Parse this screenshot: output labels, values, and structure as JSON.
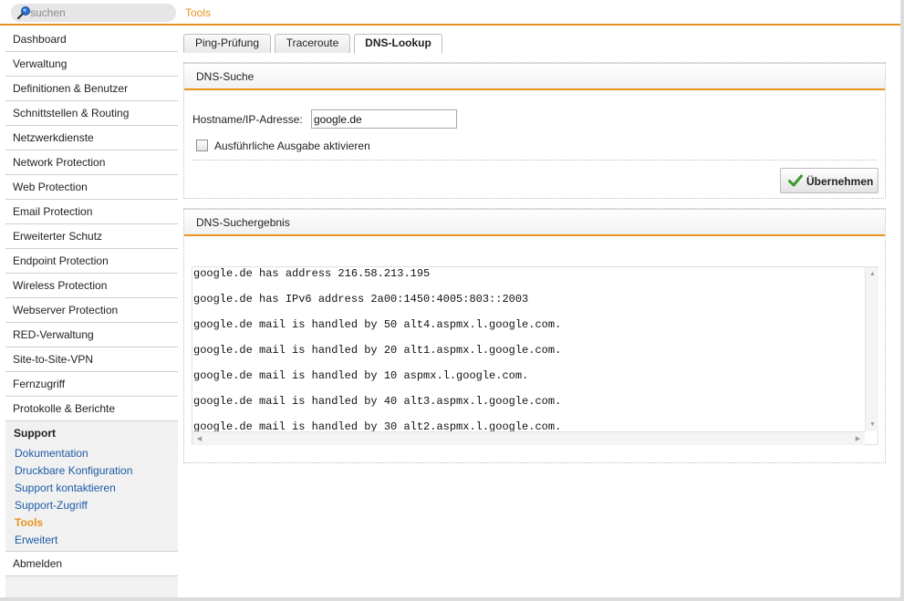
{
  "search": {
    "placeholder": "suchen"
  },
  "header": {
    "title": "Tools"
  },
  "sidebar": {
    "items": [
      "Dashboard",
      "Verwaltung",
      "Definitionen & Benutzer",
      "Schnittstellen & Routing",
      "Netzwerkdienste",
      "Network Protection",
      "Web Protection",
      "Email Protection",
      "Erweiterter Schutz",
      "Endpoint Protection",
      "Wireless Protection",
      "Webserver Protection",
      "RED-Verwaltung",
      "Site-to-Site-VPN",
      "Fernzugriff",
      "Protokolle & Berichte"
    ],
    "support": {
      "heading": "Support",
      "links": [
        "Dokumentation",
        "Druckbare Konfiguration",
        "Support kontaktieren",
        "Support-Zugriff",
        "Tools",
        "Erweitert"
      ],
      "active": "Tools"
    },
    "logout": "Abmelden"
  },
  "tabs": [
    {
      "label": "Ping-Prüfung",
      "active": false
    },
    {
      "label": "Traceroute",
      "active": false
    },
    {
      "label": "DNS-Lookup",
      "active": true
    }
  ],
  "dns_search": {
    "title": "DNS-Suche",
    "hostname_label": "Hostname/IP-Adresse:",
    "hostname_value": "google.de",
    "verbose_label": "Ausführliche Ausgabe aktivieren",
    "verbose_checked": false,
    "apply_label": "Übernehmen"
  },
  "dns_result": {
    "title": "DNS-Suchergebnis",
    "lines": [
      "google.de has address 216.58.213.195",
      "google.de has IPv6 address 2a00:1450:4005:803::2003",
      "google.de mail is handled by 50 alt4.aspmx.l.google.com.",
      "google.de mail is handled by 20 alt1.aspmx.l.google.com.",
      "google.de mail is handled by 10 aspmx.l.google.com.",
      "google.de mail is handled by 40 alt3.aspmx.l.google.com.",
      "google.de mail is handled by 30 alt2.aspmx.l.google.com."
    ]
  },
  "colors": {
    "accent": "#e8931e",
    "link": "#1c5aa5",
    "check": "#3a9a2a"
  }
}
